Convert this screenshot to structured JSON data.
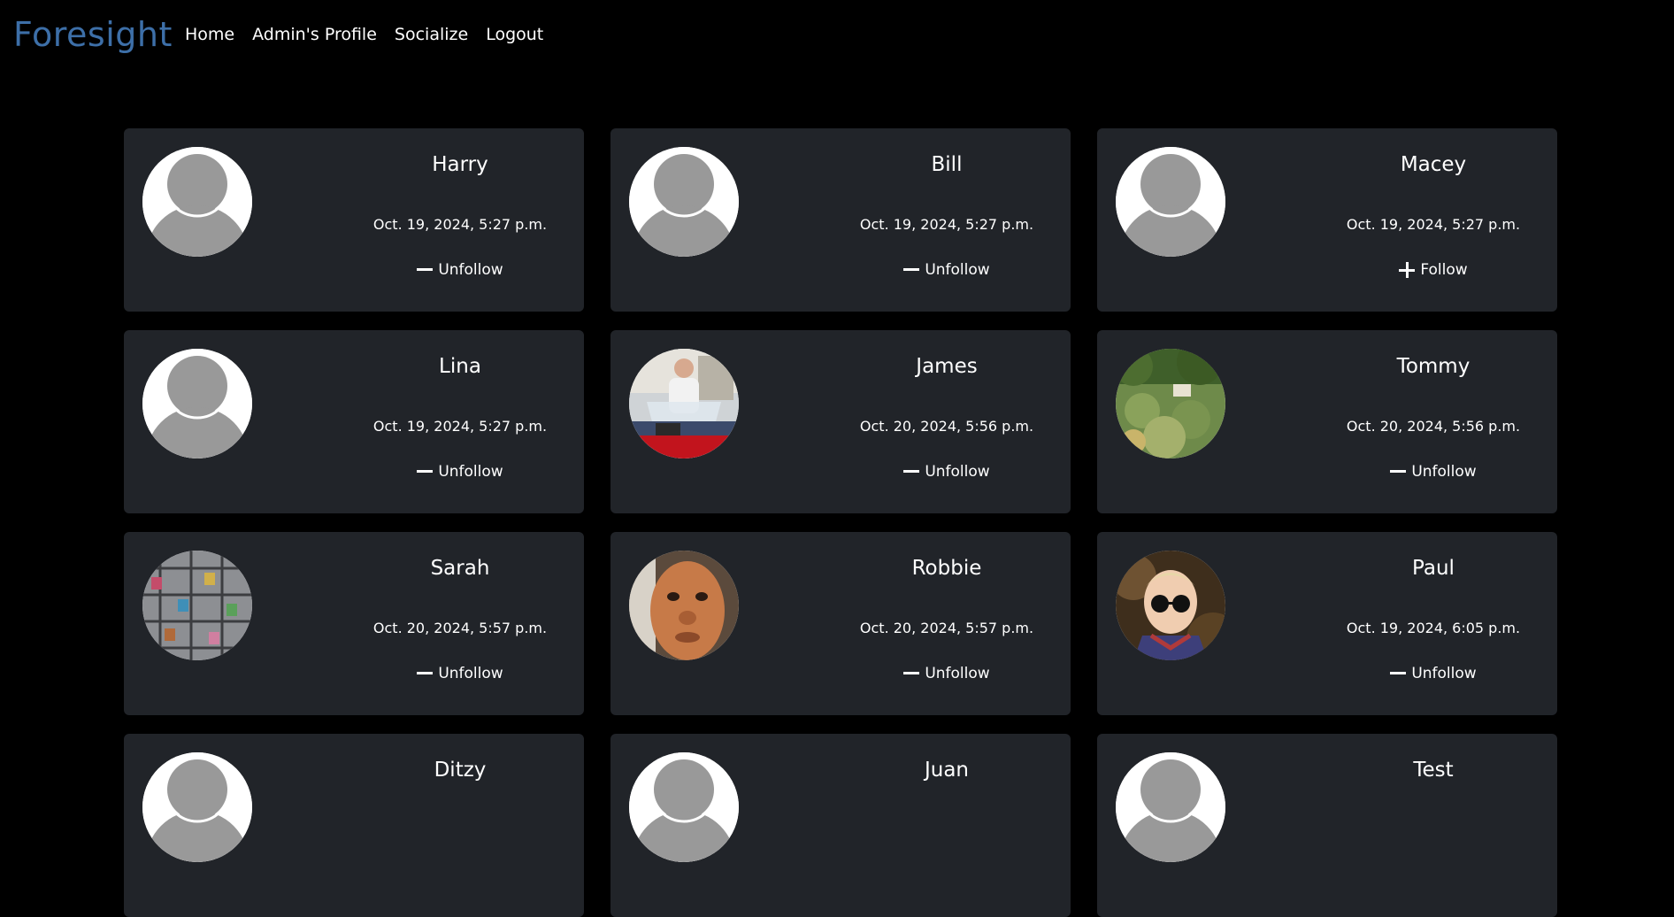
{
  "nav": {
    "brand": "Foresight",
    "links": [
      "Home",
      "Admin's Profile",
      "Socialize",
      "Logout"
    ]
  },
  "colors": {
    "background": "#000000",
    "card": "#212429",
    "brand": "#3d6fa8",
    "default_avatar_bg": "#ffffff",
    "default_avatar_fg": "#999999"
  },
  "users": [
    {
      "name": "Harry",
      "date": "Oct. 19, 2024, 5:27 p.m.",
      "action": "Unfollow",
      "action_icon": "minus-icon",
      "avatar": "default-avatar"
    },
    {
      "name": "Bill",
      "date": "Oct. 19, 2024, 5:27 p.m.",
      "action": "Unfollow",
      "action_icon": "minus-icon",
      "avatar": "default-avatar"
    },
    {
      "name": "Macey",
      "date": "Oct. 19, 2024, 5:27 p.m.",
      "action": "Follow",
      "action_icon": "plus-icon",
      "avatar": "default-avatar"
    },
    {
      "name": "Lina",
      "date": "Oct. 19, 2024, 5:27 p.m.",
      "action": "Unfollow",
      "action_icon": "minus-icon",
      "avatar": "default-avatar"
    },
    {
      "name": "James",
      "date": "Oct. 20, 2024, 5:56 p.m.",
      "action": "Unfollow",
      "action_icon": "minus-icon",
      "avatar": "photo-man-motorcycle"
    },
    {
      "name": "Tommy",
      "date": "Oct. 20, 2024, 5:56 p.m.",
      "action": "Unfollow",
      "action_icon": "minus-icon",
      "avatar": "photo-garden"
    },
    {
      "name": "Sarah",
      "date": "Oct. 20, 2024, 5:57 p.m.",
      "action": "Unfollow",
      "action_icon": "minus-icon",
      "avatar": "photo-love-locks"
    },
    {
      "name": "Robbie",
      "date": "Oct. 20, 2024, 5:57 p.m.",
      "action": "Unfollow",
      "action_icon": "minus-icon",
      "avatar": "photo-mask-face"
    },
    {
      "name": "Paul",
      "date": "Oct. 19, 2024, 6:05 p.m.",
      "action": "Unfollow",
      "action_icon": "minus-icon",
      "avatar": "photo-child-sunglasses"
    },
    {
      "name": "Ditzy",
      "date": "",
      "action": "",
      "action_icon": "",
      "avatar": "default-avatar"
    },
    {
      "name": "Juan",
      "date": "",
      "action": "",
      "action_icon": "",
      "avatar": "default-avatar"
    },
    {
      "name": "Test",
      "date": "",
      "action": "",
      "action_icon": "",
      "avatar": "default-avatar"
    }
  ]
}
